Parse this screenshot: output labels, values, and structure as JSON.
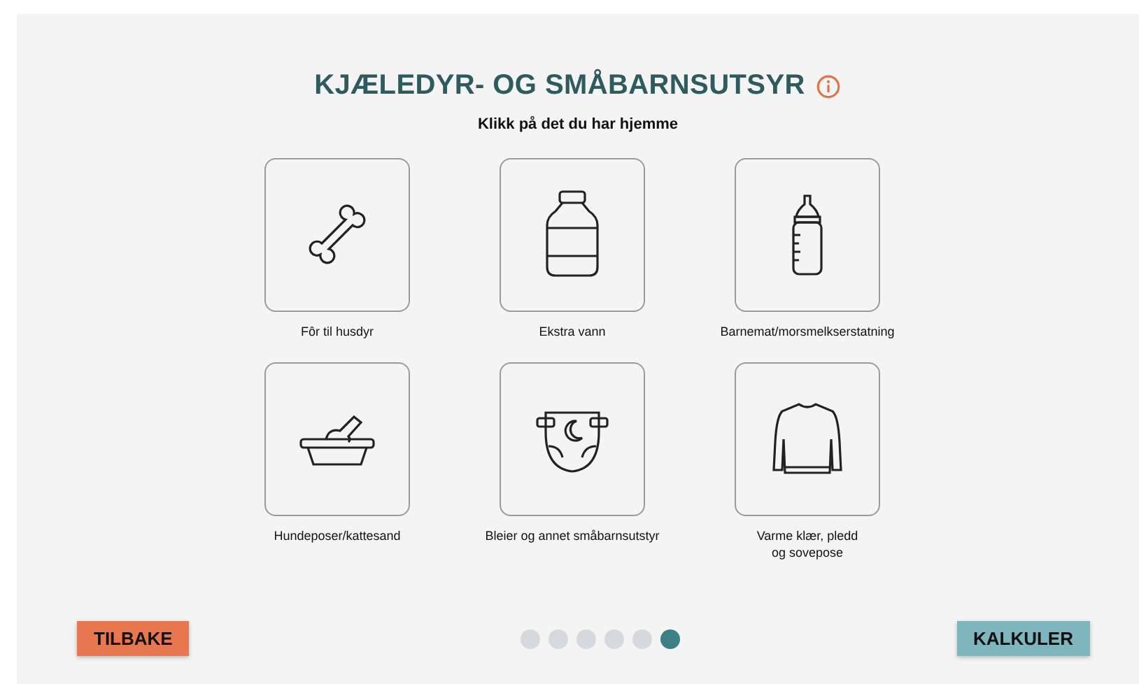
{
  "title": "KJÆLEDYR- OG SMÅBARNSUTSYR",
  "subtitle": "Klikk på det du har hjemme",
  "items": [
    {
      "label": "Fôr til husdyr",
      "selected": false
    },
    {
      "label": "Ekstra vann",
      "selected": false
    },
    {
      "label": "Barnemat/morsmelkserstatning",
      "selected": false
    },
    {
      "label": "Hundeposer/kattesand",
      "selected": false
    },
    {
      "label": "Bleier og annet småbarnsutstyr",
      "selected": false
    },
    {
      "label": "Varme klær, pledd\nog sovepose",
      "selected": false
    }
  ],
  "steps": [
    {
      "selected": false
    },
    {
      "selected": false
    },
    {
      "selected": false
    },
    {
      "selected": false
    },
    {
      "selected": false
    },
    {
      "selected": true
    }
  ],
  "back_button": "TILBAKE",
  "next_button": "KALKULER"
}
